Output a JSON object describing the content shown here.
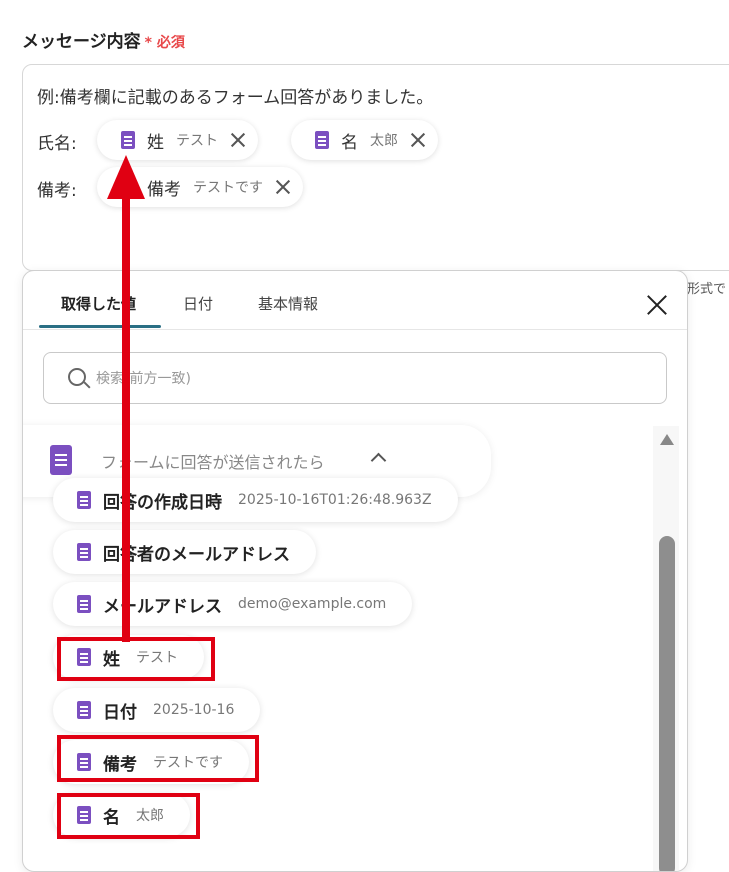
{
  "field": {
    "label": "メッセージ内容",
    "required_mark": "*",
    "required_text": "必須"
  },
  "message": {
    "first_line": "例:備考欄に記載のあるフォーム回答がありました。",
    "name_label": "氏名:",
    "note_label": "備考:",
    "chips": [
      {
        "name": "姓",
        "value": "テスト"
      },
      {
        "name": "名",
        "value": "太郎"
      },
      {
        "name": "備考",
        "value": "テストです"
      }
    ]
  },
  "side_hint": "形式で",
  "panel": {
    "tabs": [
      {
        "label": "取得した値"
      },
      {
        "label": "日付"
      },
      {
        "label": "基本情報"
      }
    ],
    "search_placeholder": "検索(前方一致)",
    "group_title": "フォームに回答が送信されたら",
    "items": [
      {
        "name": "回答の作成日時",
        "value": "2025-10-16T01:26:48.963Z"
      },
      {
        "name": "回答者のメールアドレス",
        "value": ""
      },
      {
        "name": "メールアドレス",
        "value": "demo@example.com"
      },
      {
        "name": "姓",
        "value": "テスト"
      },
      {
        "name": "日付",
        "value": "2025-10-16"
      },
      {
        "name": "備考",
        "value": "テストです"
      },
      {
        "name": "名",
        "value": "太郎"
      }
    ]
  },
  "colors": {
    "accent": "#2a6f84",
    "icon": "#7b4fc0",
    "highlight": "#e00012",
    "required": "#e8484a"
  }
}
